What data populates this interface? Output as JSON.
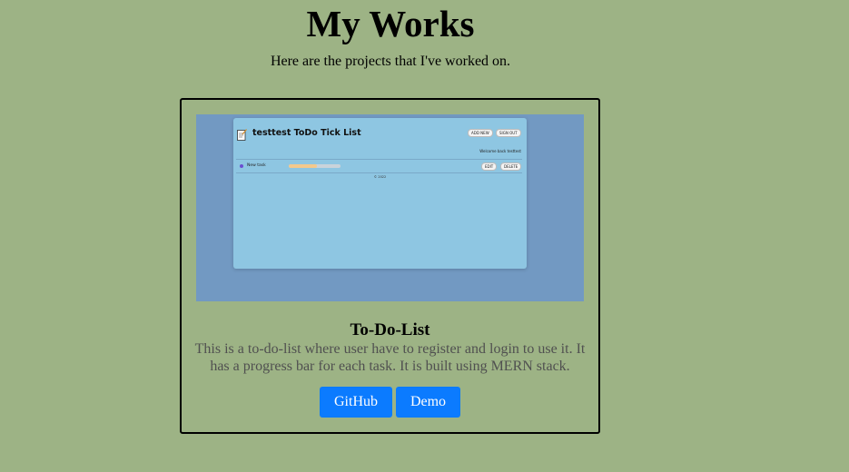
{
  "header": {
    "title": "My Works",
    "subtitle": "Here are the projects that I've worked on."
  },
  "project": {
    "title": "To-Do-List",
    "description": "This is a to-do-list where user have to register and login to use it. It has a progress bar for each task. It is built using MERN stack.",
    "buttons": {
      "github": "GitHub",
      "demo": "Demo"
    },
    "colors": {
      "page_background": "#9db385",
      "button": "#0b7bff"
    },
    "screenshot": {
      "app_title": "testtest ToDo Tick List",
      "add_new": "ADD NEW",
      "sign_out": "SIGN OUT",
      "welcome": "Welcome back testtest",
      "task": {
        "name": "New task",
        "progress": 0.55,
        "edit": "EDIT",
        "delete": "DELETE"
      },
      "copyright": "© 2022",
      "icon": "notepad-icon"
    }
  }
}
